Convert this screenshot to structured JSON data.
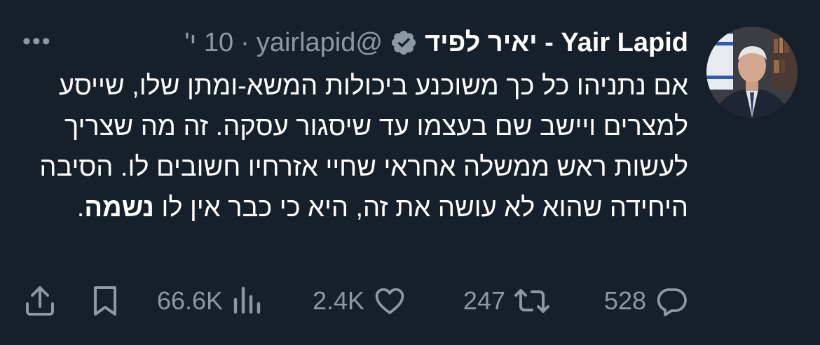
{
  "tweet": {
    "author_name": "Yair Lapid - יאיר לפיד",
    "handle": "@yairlapid",
    "separator": "·",
    "time": "10 י'",
    "more": "•••",
    "body_part1": "אם נתניהו כל כך משוכנע ביכולות המשא-ומתן שלו, שייסע למצרים ויישב שם בעצמו עד שיסגור עסקה. זה מה שצריך לעשות ראש ממשלה אחראי שחיי אזרחיו חשובים לו. הסיבה היחידה שהוא לא עושה את זה, היא כי כבר אין לו ",
    "body_bold": "נשמה",
    "body_end": "."
  },
  "actions": {
    "replies": "528",
    "reposts": "247",
    "likes": "2.4K",
    "views": "66.6K"
  },
  "icons": {
    "verified": "verified-badge-icon",
    "reply": "reply-icon",
    "repost": "repost-icon",
    "like": "heart-icon",
    "views": "views-icon",
    "bookmark": "bookmark-icon",
    "share": "share-icon"
  },
  "colors": {
    "background": "#15202b",
    "text": "#ffffff",
    "muted": "#8b98a5"
  }
}
